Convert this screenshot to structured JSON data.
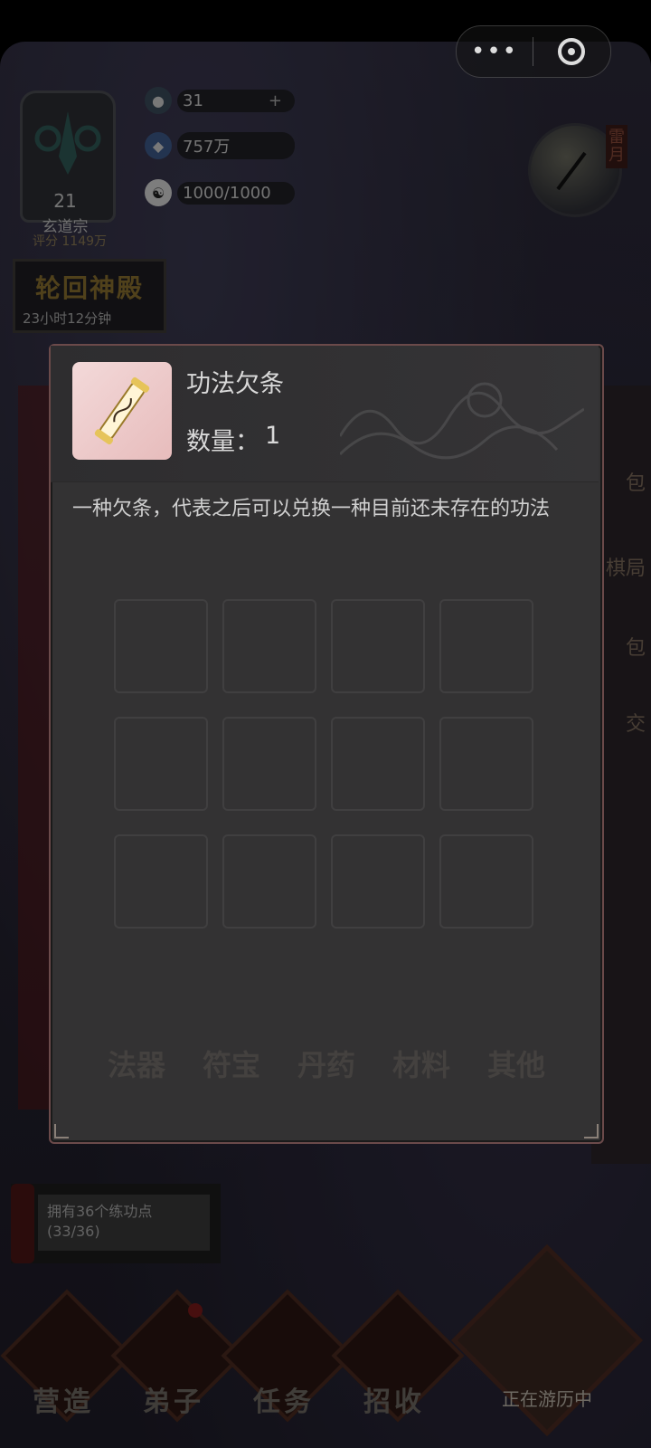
{
  "hud": {
    "sect_level": "21",
    "sect_name": "玄道宗",
    "sect_score": "评分 1149万",
    "resource_1": "31",
    "resource_1_plus": "+",
    "resource_2": "757万",
    "resource_3": "1000/1000",
    "moon_label": "雷月",
    "shrine_title": "轮回神殿",
    "shrine_timer": "23小时12分钟",
    "side_labels": [
      "包",
      "棋局",
      "包",
      "交"
    ]
  },
  "capsule": {
    "more": "•••"
  },
  "popup": {
    "item_name": "功法欠条",
    "quantity_label": "数量：",
    "quantity_value": "1",
    "description": "一种欠条，代表之后可以兑换一种目前还未存在的功法"
  },
  "background_tabs": [
    "法器",
    "符宝",
    "丹药",
    "材料",
    "其他"
  ],
  "hint": {
    "text": "拥有36个练功点(33/36)"
  },
  "nav": {
    "items": [
      "营造",
      "弟子",
      "任务",
      "招收"
    ],
    "status": "正在游历中"
  },
  "colors": {
    "popup_bg": "#333233",
    "popup_border": "#6b4a4a",
    "thumb_bg": "#f3d9d9",
    "accent_red": "#7a1a1a"
  }
}
